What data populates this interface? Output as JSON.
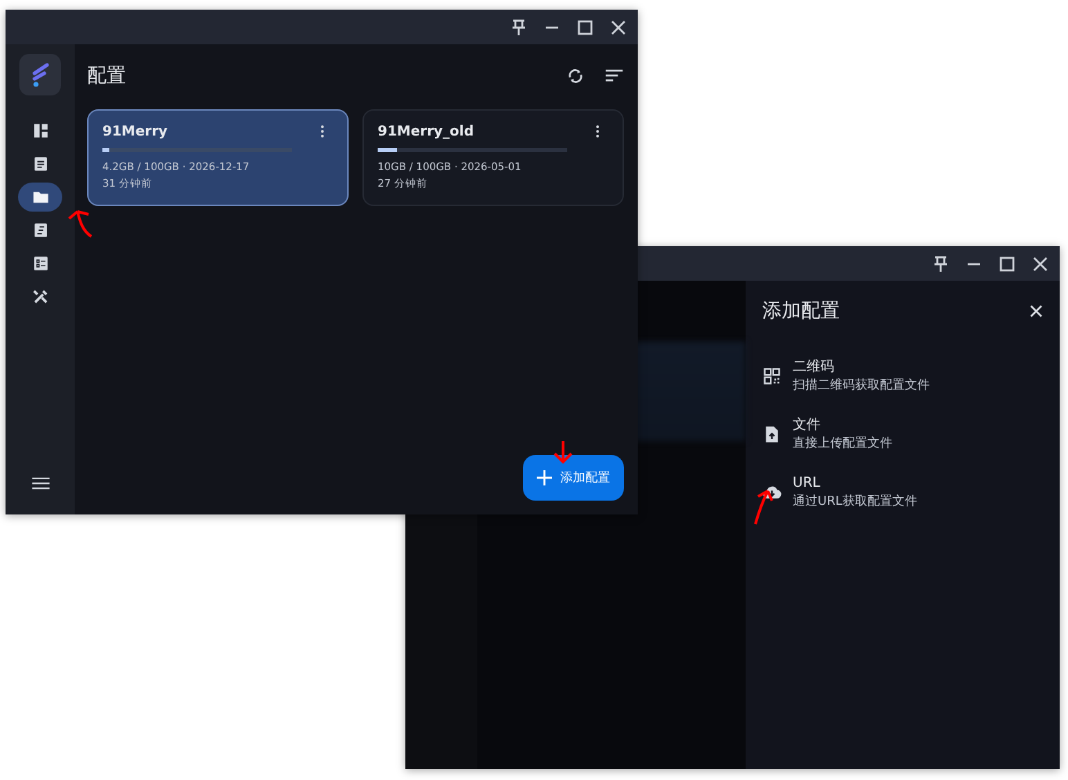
{
  "main_window": {
    "sidebar_items": [
      {
        "selected": false
      },
      {
        "selected": false
      },
      {
        "selected": true
      },
      {
        "selected": false
      },
      {
        "selected": false
      },
      {
        "selected": false
      }
    ],
    "page_title": "配置",
    "profiles": [
      {
        "name": "91Merry",
        "usage": "4.2GB / 100GB · 2026-12-17",
        "updated": "31 分钟前",
        "level": 0.04,
        "selected": true
      },
      {
        "name": "91Merry_old",
        "usage": "10GB / 100GB · 2026-05-01",
        "updated": "27 分钟前",
        "level": 0.1,
        "selected": false
      }
    ],
    "add_button": "添加配置"
  },
  "second_window": {
    "drawer": {
      "title": "添加配置",
      "options": [
        {
          "kind": "qrcode",
          "title": "二维码",
          "description": "扫描二维码获取配置文件"
        },
        {
          "kind": "file",
          "title": "文件",
          "description": "直接上传配置文件"
        },
        {
          "kind": "url",
          "title": "URL",
          "description": "通过URL获取配置文件"
        }
      ]
    }
  }
}
